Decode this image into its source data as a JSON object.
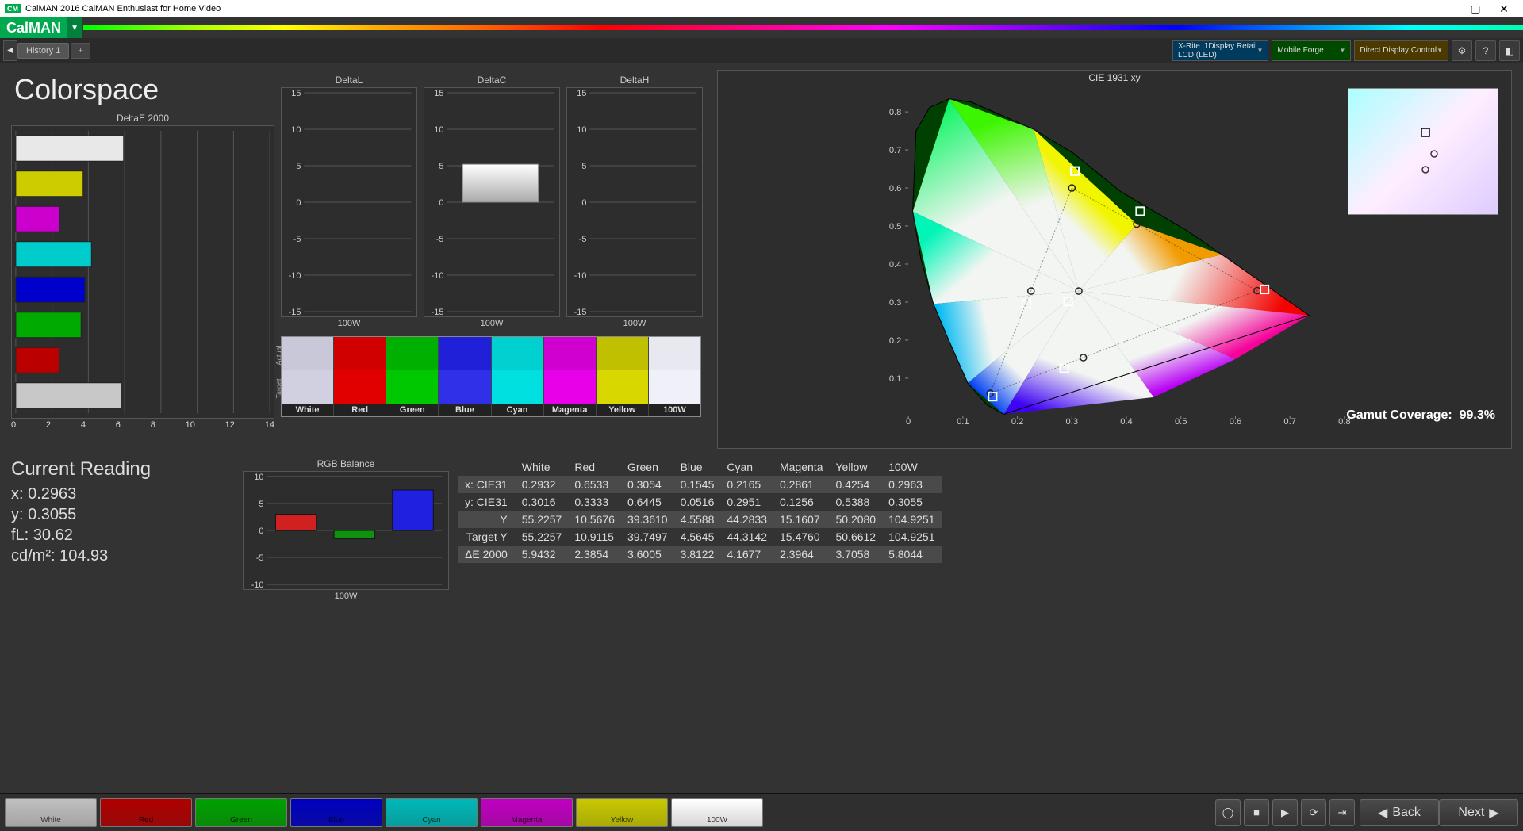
{
  "titlebar": {
    "logo_text": "CM",
    "title": "CalMAN 2016 CalMAN Enthusiast for Home Video"
  },
  "brand": {
    "name": "CalMAN"
  },
  "toolbar": {
    "tab1": "History 1",
    "tab_add": "+",
    "dd_xrite_line1": "X-Rite i1Display Retail",
    "dd_xrite_line2": "LCD (LED)",
    "dd_mobile": "Mobile Forge",
    "dd_direct": "Direct Display Control"
  },
  "page_title": "Colorspace",
  "charts": {
    "deltae2000_title": "DeltaE 2000",
    "deltal_title": "DeltaL",
    "deltac_title": "DeltaC",
    "deltah_title": "DeltaH",
    "rgb_title": "RGB Balance",
    "cie_title": "CIE 1931 xy"
  },
  "chart_data": {
    "deltae2000": {
      "type": "bar",
      "categories": [
        "White",
        "Yellow",
        "Magenta",
        "Cyan",
        "Blue",
        "Green",
        "Red",
        "100W"
      ],
      "values": [
        5.94,
        3.71,
        2.4,
        4.17,
        3.81,
        3.6,
        2.39,
        5.8
      ],
      "colors": [
        "#e8e8e8",
        "#cccc00",
        "#cc00cc",
        "#00cccc",
        "#0000cc",
        "#00aa00",
        "#bb0000",
        "#c8c8c8"
      ],
      "xlim": [
        0,
        14
      ],
      "xticks": [
        0,
        2,
        4,
        6,
        8,
        10,
        12,
        14
      ]
    },
    "delta_lch": {
      "ylim": [
        -15,
        15
      ],
      "yticks": [
        -15,
        -10,
        -5,
        0,
        5,
        10,
        15
      ],
      "xcategory": "100W",
      "L": [
        0.0
      ],
      "C": [
        5.2
      ],
      "H": [
        0.0
      ]
    },
    "swatches": {
      "names": [
        "White",
        "Red",
        "Green",
        "Blue",
        "Cyan",
        "Magenta",
        "Yellow",
        "100W"
      ],
      "actual": [
        "#c8c8d8",
        "#d00000",
        "#00b000",
        "#2020d8",
        "#00d0d0",
        "#d000d0",
        "#c0c000",
        "#e8e8f0"
      ],
      "target": [
        "#d0d0e0",
        "#e00000",
        "#00c800",
        "#3030e8",
        "#00e0e0",
        "#e800e8",
        "#d8d800",
        "#f0f0f8"
      ]
    },
    "rgb_balance": {
      "type": "bar",
      "ylim": [
        -10,
        10
      ],
      "yticks": [
        -10,
        -5,
        0,
        5,
        10
      ],
      "xcategory": "100W",
      "series": [
        {
          "name": "R",
          "value": 3.0,
          "color": "#d02020"
        },
        {
          "name": "G",
          "value": -1.5,
          "color": "#109010"
        },
        {
          "name": "B",
          "value": 7.5,
          "color": "#2020e0"
        }
      ]
    },
    "cie": {
      "xlim": [
        0.0,
        0.8
      ],
      "ylim": [
        0.0,
        0.85
      ],
      "xticks": [
        0,
        0.1,
        0.2,
        0.3,
        0.4,
        0.5,
        0.6,
        0.7,
        0.8
      ],
      "yticks": [
        0.1,
        0.2,
        0.3,
        0.4,
        0.5,
        0.6,
        0.7,
        0.8
      ],
      "gamut_coverage_label": "Gamut Coverage:",
      "gamut_coverage_value": "99.3%",
      "measured": [
        {
          "name": "Red",
          "x": 0.6533,
          "y": 0.3333
        },
        {
          "name": "Green",
          "x": 0.3054,
          "y": 0.6445
        },
        {
          "name": "Blue",
          "x": 0.1545,
          "y": 0.0516
        },
        {
          "name": "Cyan",
          "x": 0.2165,
          "y": 0.2951
        },
        {
          "name": "Magenta",
          "x": 0.2861,
          "y": 0.1256
        },
        {
          "name": "Yellow",
          "x": 0.4254,
          "y": 0.5388
        },
        {
          "name": "White",
          "x": 0.2932,
          "y": 0.3016
        }
      ],
      "targets": [
        {
          "name": "Red",
          "x": 0.64,
          "y": 0.33
        },
        {
          "name": "Green",
          "x": 0.3,
          "y": 0.6
        },
        {
          "name": "Blue",
          "x": 0.15,
          "y": 0.06
        },
        {
          "name": "Cyan",
          "x": 0.225,
          "y": 0.329
        },
        {
          "name": "Magenta",
          "x": 0.321,
          "y": 0.154
        },
        {
          "name": "Yellow",
          "x": 0.419,
          "y": 0.505
        },
        {
          "name": "White",
          "x": 0.3127,
          "y": 0.329
        }
      ]
    }
  },
  "reading": {
    "title": "Current Reading",
    "x_lbl": "x:",
    "x_val": "0.2963",
    "y_lbl": "y:",
    "y_val": "0.3055",
    "fl_lbl": "fL:",
    "fl_val": "30.62",
    "cd_lbl": "cd/m²:",
    "cd_val": "104.93"
  },
  "table": {
    "headers": [
      "",
      "White",
      "Red",
      "Green",
      "Blue",
      "Cyan",
      "Magenta",
      "Yellow",
      "100W"
    ],
    "rows": [
      {
        "lbl": "x: CIE31",
        "v": [
          "0.2932",
          "0.6533",
          "0.3054",
          "0.1545",
          "0.2165",
          "0.2861",
          "0.4254",
          "0.2963"
        ]
      },
      {
        "lbl": "y: CIE31",
        "v": [
          "0.3016",
          "0.3333",
          "0.6445",
          "0.0516",
          "0.2951",
          "0.1256",
          "0.5388",
          "0.3055"
        ]
      },
      {
        "lbl": "Y",
        "v": [
          "55.2257",
          "10.5676",
          "39.3610",
          "4.5588",
          "44.2833",
          "15.1607",
          "50.2080",
          "104.9251"
        ]
      },
      {
        "lbl": "Target Y",
        "v": [
          "55.2257",
          "10.9115",
          "39.7497",
          "4.5645",
          "44.3142",
          "15.4760",
          "50.6612",
          "104.9251"
        ]
      },
      {
        "lbl": "ΔE 2000",
        "v": [
          "5.9432",
          "2.3854",
          "3.6005",
          "3.8122",
          "4.1677",
          "2.3964",
          "3.7058",
          "5.8044"
        ]
      }
    ]
  },
  "bottom_swatches": {
    "names": [
      "White",
      "Red",
      "Green",
      "Blue",
      "Cyan",
      "Magenta",
      "Yellow",
      "100W"
    ],
    "colors": [
      "#c0c0c0",
      "#b00000",
      "#00a000",
      "#0000c0",
      "#00b8b8",
      "#c000c0",
      "#c8c800",
      "#ffffff"
    ],
    "label_colors": [
      "#333",
      "#260000",
      "#002600",
      "#000040",
      "#003030",
      "#300030",
      "#303000",
      "#333"
    ]
  },
  "nav": {
    "back": "Back",
    "next": "Next"
  }
}
